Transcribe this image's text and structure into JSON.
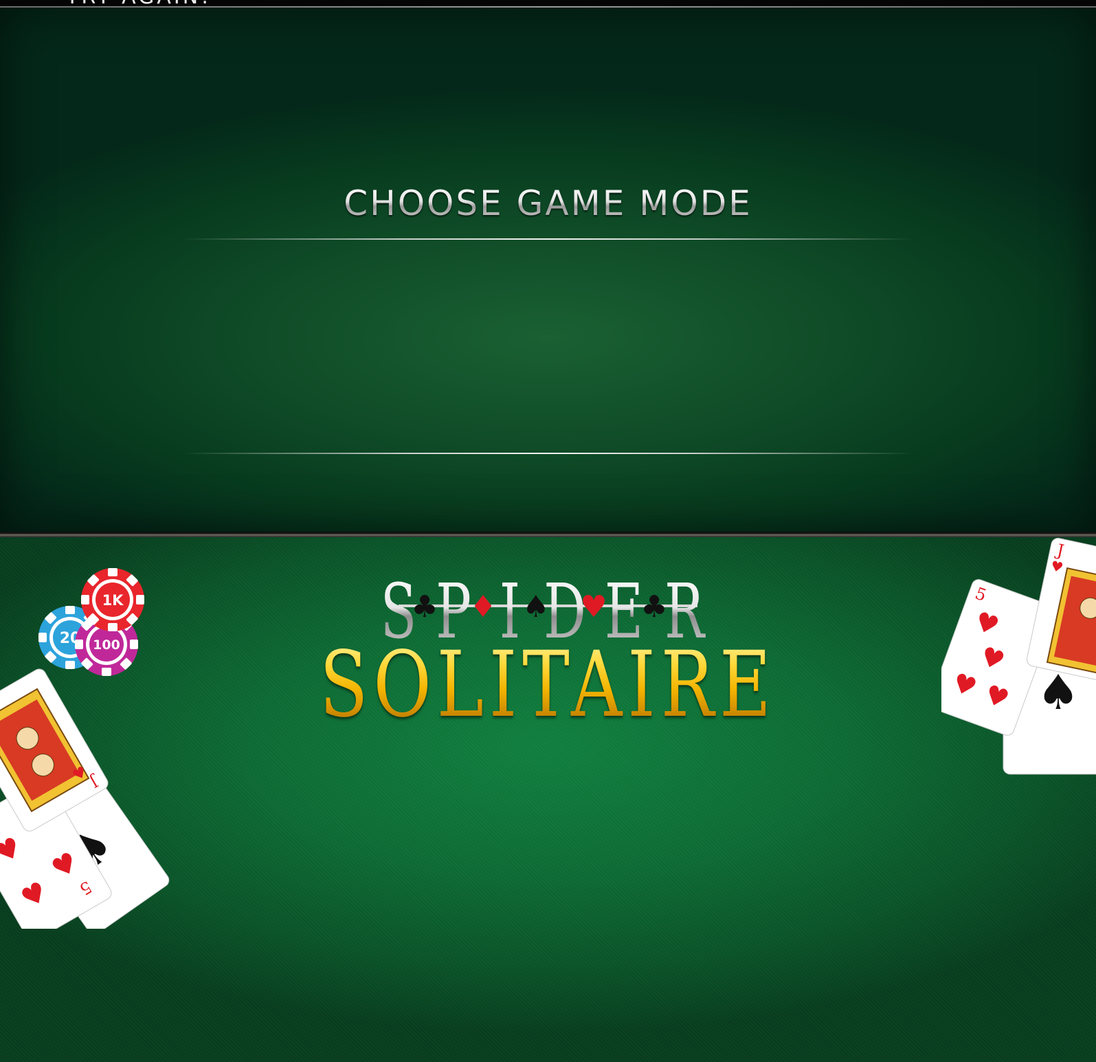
{
  "top_strip": {
    "try_again": "TRY AGAIN!"
  },
  "mode_panel": {
    "title": "CHOOSE GAME MODE"
  },
  "logo": {
    "spider_letters": [
      "S",
      "P",
      "I",
      "D",
      "E",
      "R"
    ],
    "solitaire": "SOLITAIRE"
  },
  "chips": [
    {
      "label": "1K",
      "color": "#e8262c"
    },
    {
      "label": "20",
      "color": "#2da3dc"
    },
    {
      "label": "100",
      "color": "#c0289a"
    }
  ],
  "cards": {
    "left": [
      {
        "rank": "J",
        "suit": "hearts"
      },
      {
        "rank": "5",
        "suit": "hearts"
      },
      {
        "rank": "A",
        "suit": "spades"
      }
    ],
    "right": [
      {
        "rank": "J",
        "suit": "hearts"
      },
      {
        "rank": "5",
        "suit": "hearts"
      },
      {
        "rank": "A",
        "suit": "spades"
      }
    ]
  },
  "colors": {
    "felt": "#0d6b34",
    "gold": "#f3b300",
    "red_suit": "#e01a24",
    "black_suit": "#111111"
  }
}
